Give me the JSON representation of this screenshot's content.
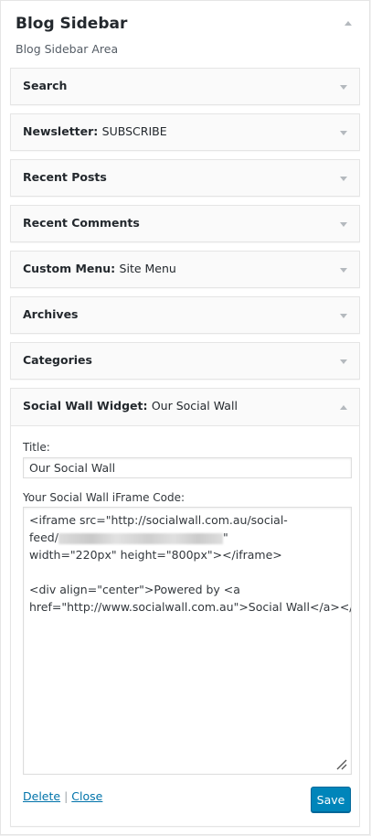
{
  "panel": {
    "title": "Blog Sidebar",
    "description": "Blog Sidebar Area"
  },
  "widgets": [
    {
      "name": "Search",
      "sub": ""
    },
    {
      "name": "Newsletter",
      "sub": "SUBSCRIBE"
    },
    {
      "name": "Recent Posts",
      "sub": ""
    },
    {
      "name": "Recent Comments",
      "sub": ""
    },
    {
      "name": "Custom Menu",
      "sub": "Site Menu"
    },
    {
      "name": "Archives",
      "sub": ""
    },
    {
      "name": "Categories",
      "sub": ""
    }
  ],
  "open_widget": {
    "name": "Social Wall Widget",
    "sub": "Our Social Wall",
    "title_label": "Title:",
    "title_value": "Our Social Wall",
    "code_label": "Your Social Wall iFrame Code:",
    "code_lines": [
      "<iframe src=\"http://socialwall.com.au/social-",
      "feed/",
      "\"",
      "width=\"220px\" height=\"800px\"></iframe>",
      "<div align=\"center\">Powered by <a",
      "href=\"http://www.socialwall.com.au\">Social Wall</a></div>"
    ],
    "delete_label": "Delete",
    "separator": "|",
    "close_label": "Close",
    "save_label": "Save"
  },
  "colors": {
    "primary": "#0085ba",
    "link": "#0073aa"
  }
}
